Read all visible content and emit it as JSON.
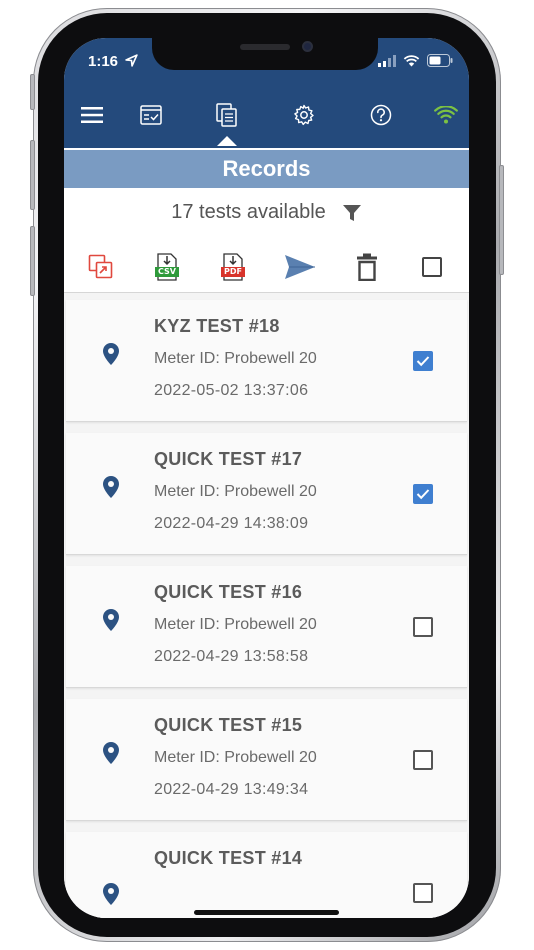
{
  "status_bar": {
    "time": "1:16"
  },
  "toolbar": {
    "items": [
      "menu-icon",
      "checklist-icon",
      "records-icon",
      "gear-icon",
      "help-icon",
      "wifi-icon"
    ],
    "active": "records-icon",
    "wifi_color": "#7cc243"
  },
  "header": {
    "title": "Records"
  },
  "summary": {
    "available_text": "17 tests available"
  },
  "actions": {
    "items": [
      "export-icon",
      "csv-icon",
      "pdf-icon",
      "send-icon",
      "trash-icon",
      "select-all-checkbox"
    ],
    "csv_label": "CSV",
    "pdf_label": "PDF"
  },
  "colors": {
    "appbar": "#244a7c",
    "records_bar": "#7a9bc2",
    "accent_blue": "#3f7fd0",
    "export_red": "#e0483e",
    "csv_green": "#2e9a3a",
    "pdf_red": "#d8342b"
  },
  "records": [
    {
      "title": "KYZ TEST #18",
      "meter": "Meter ID: Probewell 20",
      "date": "2022-05-02 13:37:06",
      "checked": true
    },
    {
      "title": "QUICK TEST #17",
      "meter": "Meter ID: Probewell 20",
      "date": "2022-04-29 14:38:09",
      "checked": true
    },
    {
      "title": "QUICK TEST #16",
      "meter": "Meter ID: Probewell 20",
      "date": "2022-04-29 13:58:58",
      "checked": false
    },
    {
      "title": "QUICK TEST #15",
      "meter": "Meter ID: Probewell 20",
      "date": "2022-04-29 13:49:34",
      "checked": false
    },
    {
      "title": "QUICK TEST #14",
      "meter": "",
      "date": "",
      "checked": false
    }
  ]
}
